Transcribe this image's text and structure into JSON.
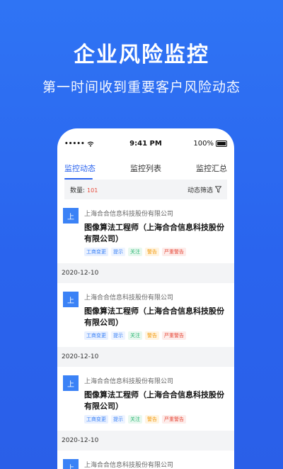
{
  "hero": {
    "title": "企业风险监控",
    "subtitle": "第一时间收到重要客户风险动态"
  },
  "status_bar": {
    "signal": "•••••",
    "time": "9:41 PM",
    "battery": "100%"
  },
  "tabs": [
    {
      "label": "监控动态",
      "active": true
    },
    {
      "label": "监控列表",
      "active": false
    },
    {
      "label": "监控汇总",
      "active": false
    }
  ],
  "filter": {
    "count_label": "数量:",
    "count_value": "101",
    "filter_label": "动态筛选"
  },
  "cards": [
    {
      "avatar": "上",
      "company": "上海合合信息科技股份有限公司",
      "title": "图像算法工程师（上海合合信息科技股份有限公司）",
      "tags": [
        "工商变更",
        "提示",
        "关注",
        "警告",
        "严重警告"
      ]
    },
    {
      "avatar": "上",
      "company": "上海合合信息科技股份有限公司",
      "title": "图像算法工程师（上海合合信息科技股份有限公司）",
      "tags": [
        "工商变更",
        "提示",
        "关注",
        "警告",
        "严重警告"
      ]
    },
    {
      "avatar": "上",
      "company": "上海合合信息科技股份有限公司",
      "title": "图像算法工程师（上海合合信息科技股份有限公司）",
      "tags": [
        "工商变更",
        "提示",
        "关注",
        "警告",
        "严重警告"
      ]
    },
    {
      "avatar": "上",
      "company": "上海合合信息科技股份有限公司"
    }
  ],
  "dates": [
    "2020-12-10",
    "2020-12-10",
    "2020-12-10"
  ],
  "colors": {
    "background": "#2a64ee",
    "accent": "#2a63ee",
    "avatar": "#3b82f6",
    "count": "#e74c3c"
  }
}
